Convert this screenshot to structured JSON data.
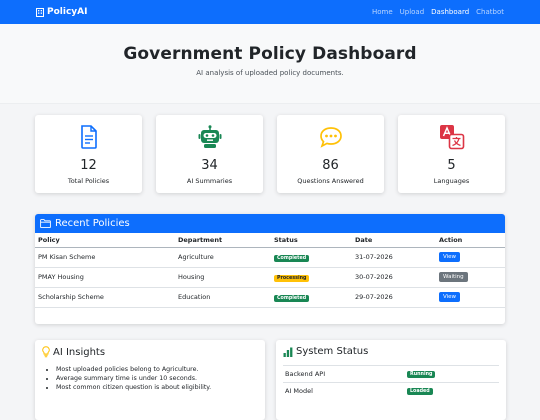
{
  "navbar": {
    "brand": "PolicyAI",
    "links": [
      {
        "label": "Home",
        "active": false
      },
      {
        "label": "Upload",
        "active": false
      },
      {
        "label": "Dashboard",
        "active": true
      },
      {
        "label": "Chatbot",
        "active": false
      }
    ]
  },
  "hero": {
    "title": "Government Policy Dashboard",
    "subtitle": "AI analysis of uploaded policy documents."
  },
  "stats": [
    {
      "icon": "document-icon",
      "value": "12",
      "label": "Total Policies",
      "color": "#0d6efd"
    },
    {
      "icon": "robot-icon",
      "value": "34",
      "label": "AI Summaries",
      "color": "#198754"
    },
    {
      "icon": "chat-icon",
      "value": "86",
      "label": "Questions Answered",
      "color": "#ffc107"
    },
    {
      "icon": "translate-icon",
      "value": "5",
      "label": "Languages",
      "color": "#dc3545"
    }
  ],
  "recent": {
    "title": "Recent Policies",
    "headers": [
      "Policy",
      "Department",
      "Status",
      "Date",
      "Action"
    ],
    "rows": [
      {
        "policy": "PM Kisan Scheme",
        "department": "Agriculture",
        "status": "Completed",
        "date": "31-07-2026",
        "action": "View"
      },
      {
        "policy": "PMAY Housing",
        "department": "Housing",
        "status": "Processing",
        "date": "30-07-2026",
        "action": "Waiting"
      },
      {
        "policy": "Scholarship Scheme",
        "department": "Education",
        "status": "Completed",
        "date": "29-07-2026",
        "action": "View"
      }
    ]
  },
  "insights": {
    "title": "AI Insights",
    "items": [
      "Most uploaded policies belong to Agriculture.",
      "Average summary time is under 10 seconds.",
      "Most common citizen question is about eligibility."
    ]
  },
  "system": {
    "title": "System Status",
    "rows": [
      {
        "name": "Backend API",
        "status": "Running"
      },
      {
        "name": "AI Model",
        "status": "Loaded"
      }
    ]
  },
  "colors": {
    "primary": "#0d6efd",
    "success": "#198754",
    "warning": "#ffc107",
    "danger": "#dc3545"
  }
}
